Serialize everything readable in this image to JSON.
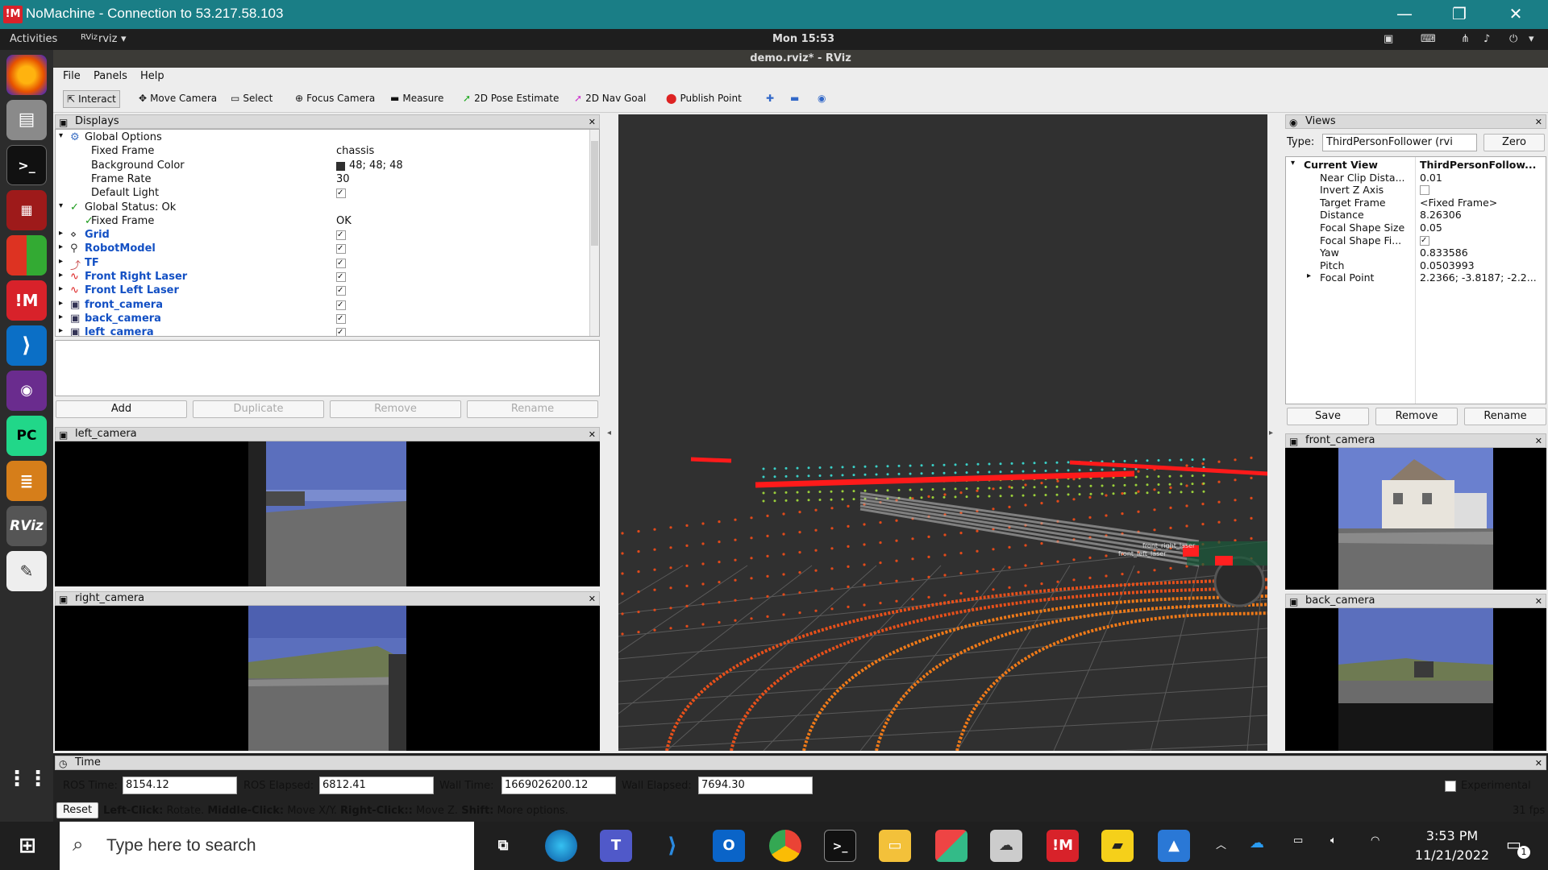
{
  "nomachine": {
    "logo": "!M",
    "title": "NoMachine - Connection to 53.217.58.103",
    "minimize": "—",
    "restore": "❐",
    "close": "✕"
  },
  "gnome": {
    "activities": "Activities",
    "app": "rviz",
    "app_arrow": "▾",
    "clock": "Mon 15:53"
  },
  "rviz": {
    "window_title": "demo.rviz* - RViz",
    "menu": [
      "File",
      "Panels",
      "Help"
    ],
    "toolbar": {
      "interact": "Interact",
      "move_camera": "Move Camera",
      "select": "Select",
      "focus_camera": "Focus Camera",
      "measure": "Measure",
      "pose_estimate": "2D Pose Estimate",
      "nav_goal": "2D Nav Goal",
      "publish_point": "Publish Point"
    },
    "displays": {
      "title": "Displays",
      "rows": [
        {
          "name": "Global Options",
          "value": ""
        },
        {
          "name": "Fixed Frame",
          "value": "chassis"
        },
        {
          "name": "Background Color",
          "value": "48; 48; 48"
        },
        {
          "name": "Frame Rate",
          "value": "30"
        },
        {
          "name": "Default Light",
          "value": "✓"
        },
        {
          "name": "Global Status: Ok",
          "value": ""
        },
        {
          "name": "Fixed Frame",
          "value": "OK"
        },
        {
          "name": "Grid",
          "value": "✓"
        },
        {
          "name": "RobotModel",
          "value": "✓"
        },
        {
          "name": "TF",
          "value": "✓"
        },
        {
          "name": "Front Right Laser",
          "value": "✓"
        },
        {
          "name": "Front Left Laser",
          "value": "✓"
        },
        {
          "name": "front_camera",
          "value": "✓"
        },
        {
          "name": "back_camera",
          "value": "✓"
        },
        {
          "name": "left_camera",
          "value": "✓"
        }
      ],
      "buttons": {
        "add": "Add",
        "duplicate": "Duplicate",
        "remove": "Remove",
        "rename": "Rename"
      }
    },
    "left_camera": {
      "title": "left_camera"
    },
    "right_camera": {
      "title": "right_camera"
    },
    "views": {
      "title": "Views",
      "type_label": "Type:",
      "type_value": "ThirdPersonFollower (rvi",
      "zero": "Zero",
      "rows": [
        {
          "name": "Current View",
          "value": "ThirdPersonFollow..."
        },
        {
          "name": "Near Clip Dista...",
          "value": "0.01"
        },
        {
          "name": "Invert Z Axis",
          "value": ""
        },
        {
          "name": "Target Frame",
          "value": "<Fixed Frame>"
        },
        {
          "name": "Distance",
          "value": "8.26306"
        },
        {
          "name": "Focal Shape Size",
          "value": "0.05"
        },
        {
          "name": "Focal Shape Fi...",
          "value": "✓"
        },
        {
          "name": "Yaw",
          "value": "0.833586"
        },
        {
          "name": "Pitch",
          "value": "0.0503993"
        },
        {
          "name": "Focal Point",
          "value": "2.2366; -3.8187; -2.2..."
        }
      ],
      "buttons": {
        "save": "Save",
        "remove": "Remove",
        "rename": "Rename"
      }
    },
    "front_camera": {
      "title": "front_camera"
    },
    "back_camera": {
      "title": "back_camera"
    },
    "time": {
      "title": "Time",
      "ros_time_label": "ROS Time:",
      "ros_time": "8154.12",
      "ros_elapsed_label": "ROS Elapsed:",
      "ros_elapsed": "6812.41",
      "wall_time_label": "Wall Time:",
      "wall_time": "1669026200.12",
      "wall_elapsed_label": "Wall Elapsed:",
      "wall_elapsed": "7694.30",
      "experimental": "Experimental"
    },
    "status": {
      "reset": "Reset",
      "left_click": "Left-Click:",
      "left_action": "Rotate.",
      "middle_click": "Middle-Click:",
      "middle_action": "Move X/Y.",
      "right_click": "Right-Click::",
      "right_action": "Move Z.",
      "shift": "Shift:",
      "shift_action": "More options.",
      "fps": "31 fps"
    },
    "viewport_labels": [
      "front_left_laser",
      "front_right_laser"
    ]
  },
  "taskbar": {
    "search_placeholder": "Type here to search",
    "time": "3:53 PM",
    "date": "11/21/2022",
    "notifications": "1"
  },
  "dock": {
    "rviz": "RViz",
    "pc": "PC",
    "nm": "!M"
  },
  "colors": {
    "titlebar": "#1a7e86",
    "laser": "#ff3a14",
    "points_cyan": "#3ad0c8"
  }
}
